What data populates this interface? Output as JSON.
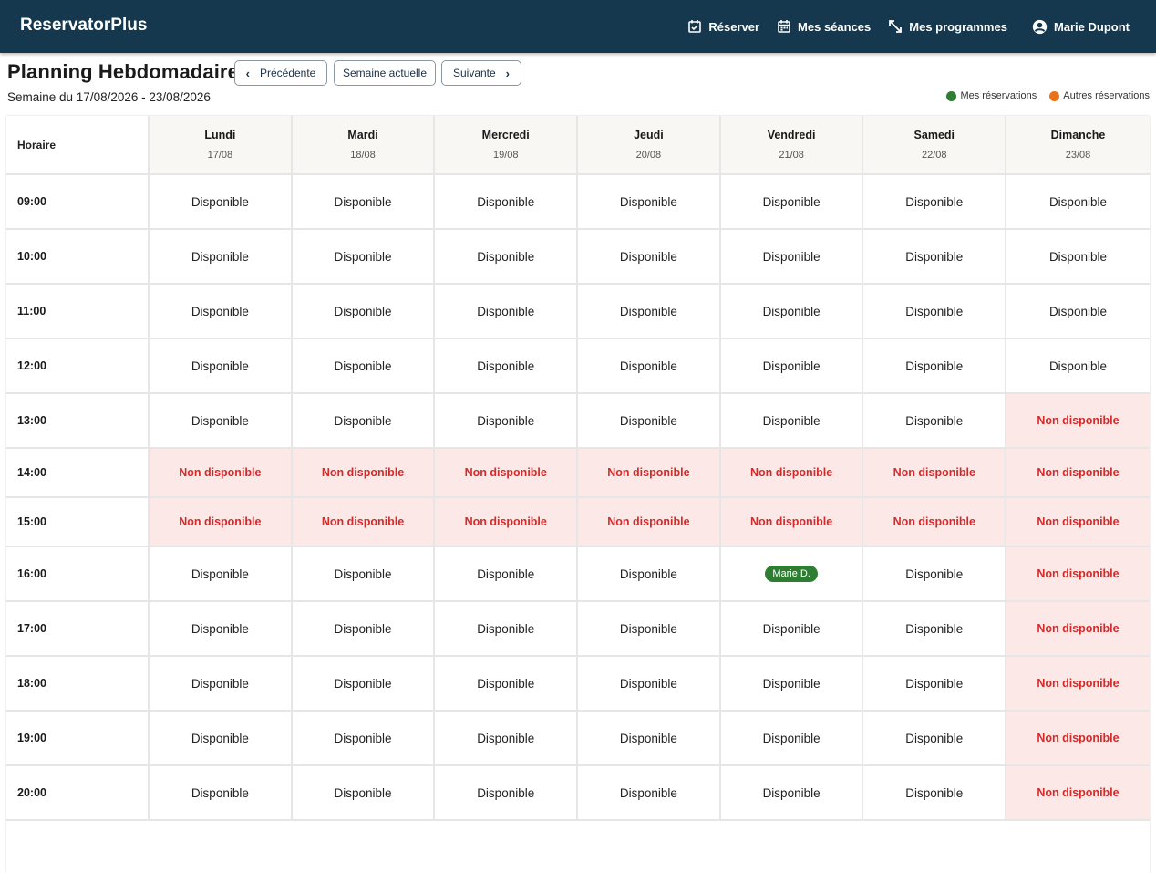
{
  "app": {
    "title": "ReservatorPlus"
  },
  "nav": [
    {
      "icon": "calendar-check-icon",
      "label": "Réserver"
    },
    {
      "icon": "calendar-icon",
      "label": "Mes séances"
    },
    {
      "icon": "expand-arrows-icon",
      "label": "Mes programmes"
    }
  ],
  "user": {
    "icon": "account-circle-icon",
    "name": "Marie Dupont"
  },
  "page": {
    "title": "Planning Hebdomadaire",
    "week_label": "Semaine du 17/08/2026 - 23/08/2026",
    "prev_label": "Précédente",
    "current_label": "Semaine actuelle",
    "next_label": "Suivante"
  },
  "legend": [
    {
      "label": "Mes réservations",
      "color": "#2e7d32"
    },
    {
      "label": "Autres réservations",
      "color": "#e8731a"
    }
  ],
  "table": {
    "time_header": "Horaire",
    "days": [
      {
        "name": "Lundi",
        "date": "17/08"
      },
      {
        "name": "Mardi",
        "date": "18/08"
      },
      {
        "name": "Mercredi",
        "date": "19/08"
      },
      {
        "name": "Jeudi",
        "date": "20/08"
      },
      {
        "name": "Vendredi",
        "date": "21/08"
      },
      {
        "name": "Samedi",
        "date": "22/08"
      },
      {
        "name": "Dimanche",
        "date": "23/08"
      }
    ],
    "status_labels": {
      "A": "Disponible",
      "U": "Non disponible"
    },
    "rows": [
      {
        "time": "09:00",
        "slots": [
          "A",
          "A",
          "A",
          "A",
          "A",
          "A",
          "A"
        ]
      },
      {
        "time": "10:00",
        "slots": [
          "A",
          "A",
          "A",
          "A",
          "A",
          "A",
          "A"
        ]
      },
      {
        "time": "11:00",
        "slots": [
          "A",
          "A",
          "A",
          "A",
          "A",
          "A",
          "A"
        ]
      },
      {
        "time": "12:00",
        "slots": [
          "A",
          "A",
          "A",
          "A",
          "A",
          "A",
          "A"
        ]
      },
      {
        "time": "13:00",
        "slots": [
          "A",
          "A",
          "A",
          "A",
          "A",
          "A",
          "U"
        ]
      },
      {
        "time": "14:00",
        "slots": [
          "U",
          "U",
          "U",
          "U",
          "U",
          "U",
          "U"
        ]
      },
      {
        "time": "15:00",
        "slots": [
          "U",
          "U",
          "U",
          "U",
          "U",
          "U",
          "U"
        ]
      },
      {
        "time": "16:00",
        "slots": [
          "A",
          "A",
          "A",
          "A",
          "Marie D.",
          "A",
          "U"
        ]
      },
      {
        "time": "17:00",
        "slots": [
          "A",
          "A",
          "A",
          "A",
          "A",
          "A",
          "U"
        ]
      },
      {
        "time": "18:00",
        "slots": [
          "A",
          "A",
          "A",
          "A",
          "A",
          "A",
          "U"
        ]
      },
      {
        "time": "19:00",
        "slots": [
          "A",
          "A",
          "A",
          "A",
          "A",
          "A",
          "U"
        ]
      },
      {
        "time": "20:00",
        "slots": [
          "A",
          "A",
          "A",
          "A",
          "A",
          "A",
          "U"
        ]
      }
    ]
  }
}
